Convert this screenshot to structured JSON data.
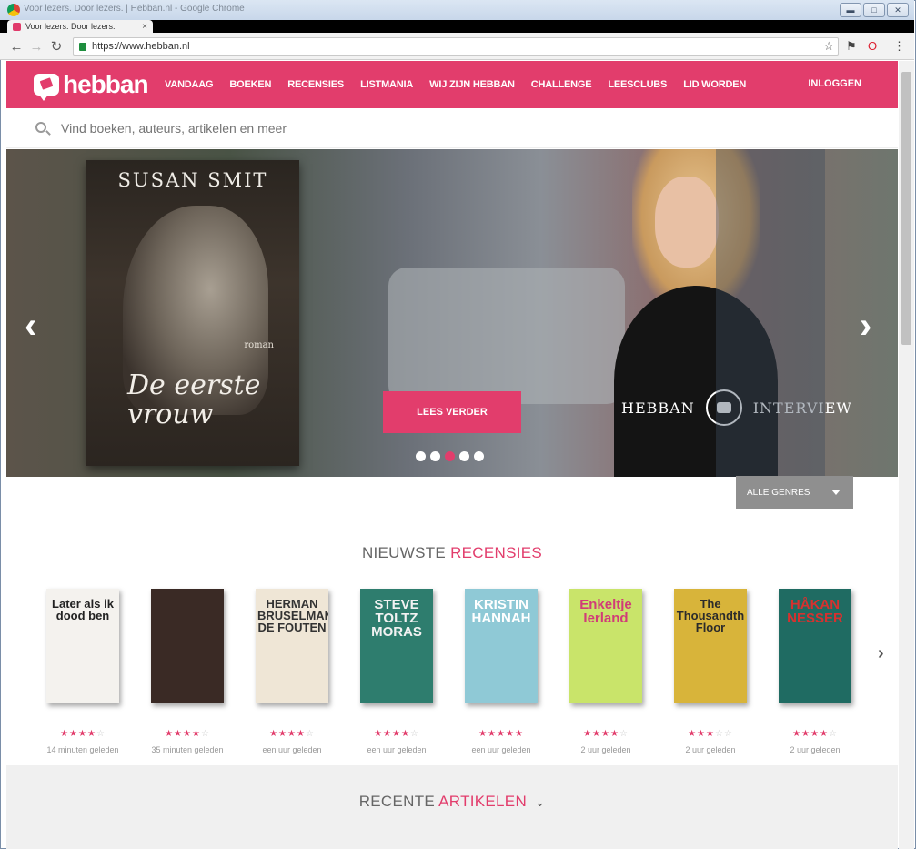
{
  "browser": {
    "window_title": "Voor lezers. Door lezers. | Hebban.nl - Google Chrome",
    "tab_label": "Voor lezers. Door lezers.",
    "url": "https://www.hebban.nl"
  },
  "nav": {
    "logo": "hebban",
    "items": [
      "VANDAAG",
      "BOEKEN",
      "RECENSIES",
      "LISTMANIA",
      "WIJ ZIJN HEBBAN",
      "CHALLENGE",
      "LEESCLUBS",
      "LID WORDEN"
    ],
    "login": "INLOGGEN"
  },
  "search": {
    "placeholder": "Vind boeken, auteurs, artikelen en meer"
  },
  "hero": {
    "book_author": "SUSAN SMIT",
    "book_genre": "roman",
    "book_title_line1": "De eerste",
    "book_title_line2": "vrouw",
    "button": "LEES VERDER",
    "label_left": "HEBBAN",
    "label_right": "INTERVIEW",
    "slides": 5,
    "active_slide": 3
  },
  "genres": {
    "selected": "ALLE GENRES"
  },
  "recensies": {
    "title_plain": "NIEUWSTE",
    "title_accent": "RECENSIES",
    "books": [
      {
        "cover_title": "Later als ik dood ben",
        "rating": 4,
        "time": "14 minuten geleden",
        "bg": "#f4f2ee",
        "fg": "#222222"
      },
      {
        "cover_title": "",
        "rating": 4,
        "time": "35 minuten geleden",
        "bg": "#3a2a25",
        "fg": "#c0392b"
      },
      {
        "cover_title": "HERMAN BRUSELMANS DE FOUTEN",
        "rating": 4,
        "time": "een uur geleden",
        "bg": "#efe6d6",
        "fg": "#333333"
      },
      {
        "cover_title": "STEVE TOLTZ MORAS",
        "rating": 4,
        "time": "een uur geleden",
        "bg": "#2e7d6e",
        "fg": "#f2f2f2"
      },
      {
        "cover_title": "KRISTIN HANNAH",
        "rating": 5,
        "time": "een uur geleden",
        "bg": "#8fc9d6",
        "fg": "#ffffff"
      },
      {
        "cover_title": "Enkeltje Ierland",
        "rating": 4,
        "time": "2 uur geleden",
        "bg": "#c9e46a",
        "fg": "#d13b78"
      },
      {
        "cover_title": "The Thousandth Floor",
        "rating": 3,
        "time": "2 uur geleden",
        "bg": "#d8b43a",
        "fg": "#2b2b2b"
      },
      {
        "cover_title": "HÅKAN NESSER",
        "rating": 4,
        "time": "2 uur geleden",
        "bg": "#1f6b62",
        "fg": "#d6312f"
      }
    ]
  },
  "artikelen": {
    "title_plain": "RECENTE",
    "title_accent": "ARTIKELEN"
  },
  "colors": {
    "brand": "#e23d6c",
    "gray_button": "#8f8f8f"
  }
}
